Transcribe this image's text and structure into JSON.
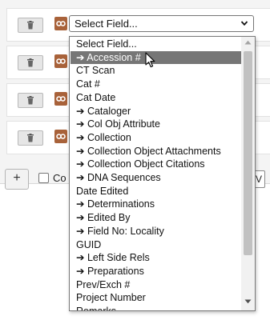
{
  "field_select": {
    "selected_label": "Select Field..."
  },
  "footer": {
    "add_label": "+",
    "count_label": "Co",
    "right_button_label": "V"
  },
  "dropdown": {
    "options": [
      {
        "label": "Select Field...",
        "highlighted": false
      },
      {
        "label": "➔ Accession #",
        "highlighted": true
      },
      {
        "label": "CT Scan",
        "highlighted": false
      },
      {
        "label": "Cat #",
        "highlighted": false
      },
      {
        "label": "Cat Date",
        "highlighted": false
      },
      {
        "label": "➔ Cataloger",
        "highlighted": false
      },
      {
        "label": "➔ Col Obj Attribute",
        "highlighted": false
      },
      {
        "label": "➔ Collection",
        "highlighted": false
      },
      {
        "label": "➔ Collection Object Attachments",
        "highlighted": false
      },
      {
        "label": "➔ Collection Object Citations",
        "highlighted": false
      },
      {
        "label": "➔ DNA Sequences",
        "highlighted": false
      },
      {
        "label": "Date Edited",
        "highlighted": false
      },
      {
        "label": "➔ Determinations",
        "highlighted": false
      },
      {
        "label": "➔ Edited By",
        "highlighted": false
      },
      {
        "label": "➔ Field No: Locality",
        "highlighted": false
      },
      {
        "label": "GUID",
        "highlighted": false
      },
      {
        "label": "➔ Left Side Rels",
        "highlighted": false
      },
      {
        "label": "➔ Preparations",
        "highlighted": false
      },
      {
        "label": "Prev/Exch #",
        "highlighted": false
      },
      {
        "label": "Project Number",
        "highlighted": false
      },
      {
        "label": "Remarks",
        "highlighted": false
      }
    ]
  },
  "colors": {
    "table_icon": "#a8623a",
    "highlight": "#767676"
  },
  "icons": {
    "remove": "trash-icon",
    "table": "collection-object-table-icon"
  }
}
